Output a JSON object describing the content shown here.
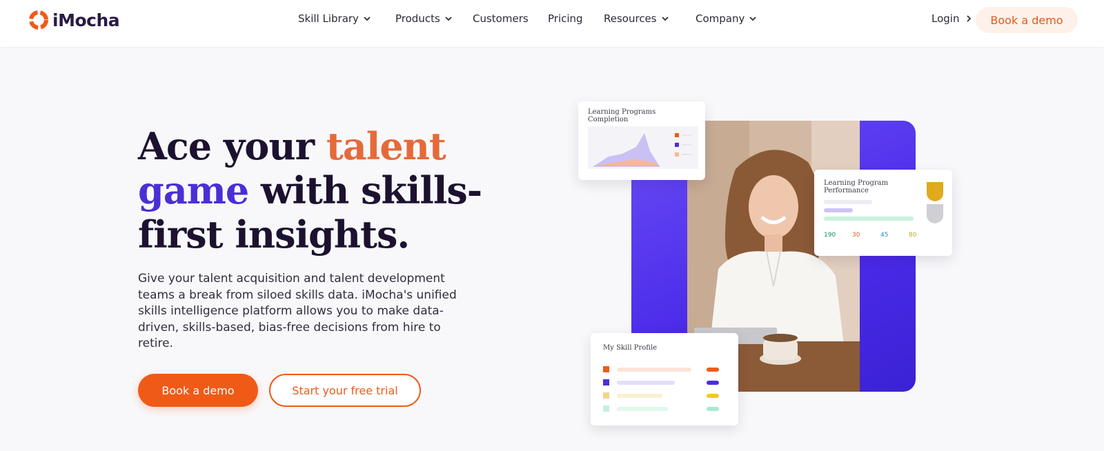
{
  "brand": {
    "name": "iMocha",
    "accent": "#f05a17",
    "purple": "#4a2fd6"
  },
  "nav": {
    "items": [
      {
        "label": "Skill Library",
        "dropdown": true
      },
      {
        "label": "Products",
        "dropdown": true
      },
      {
        "label": "Customers",
        "dropdown": false
      },
      {
        "label": "Pricing",
        "dropdown": false
      },
      {
        "label": "Resources",
        "dropdown": true
      },
      {
        "label": "Company",
        "dropdown": true
      }
    ],
    "login_label": "Login",
    "cta_label": "Book a demo"
  },
  "hero": {
    "headline_1": "Ace your ",
    "headline_2": "talent",
    "headline_3": "game",
    "headline_4": " with skills-",
    "headline_5": "first insights.",
    "lead": "Give your talent acquisition and talent development teams a break from siloed skills data. iMocha's unified skills intelligence platform allows you to make data-driven, skills-based, bias-free decisions from hire to retire.",
    "primary_cta": "Book a demo",
    "secondary_cta": "Start your free trial"
  },
  "cards": {
    "completion_title": "Learning Programs Completion",
    "performance_title": "Learning Program Performance",
    "performance_values": [
      "190",
      "30",
      "45",
      "80"
    ],
    "skill_title": "My Skill Profile"
  }
}
